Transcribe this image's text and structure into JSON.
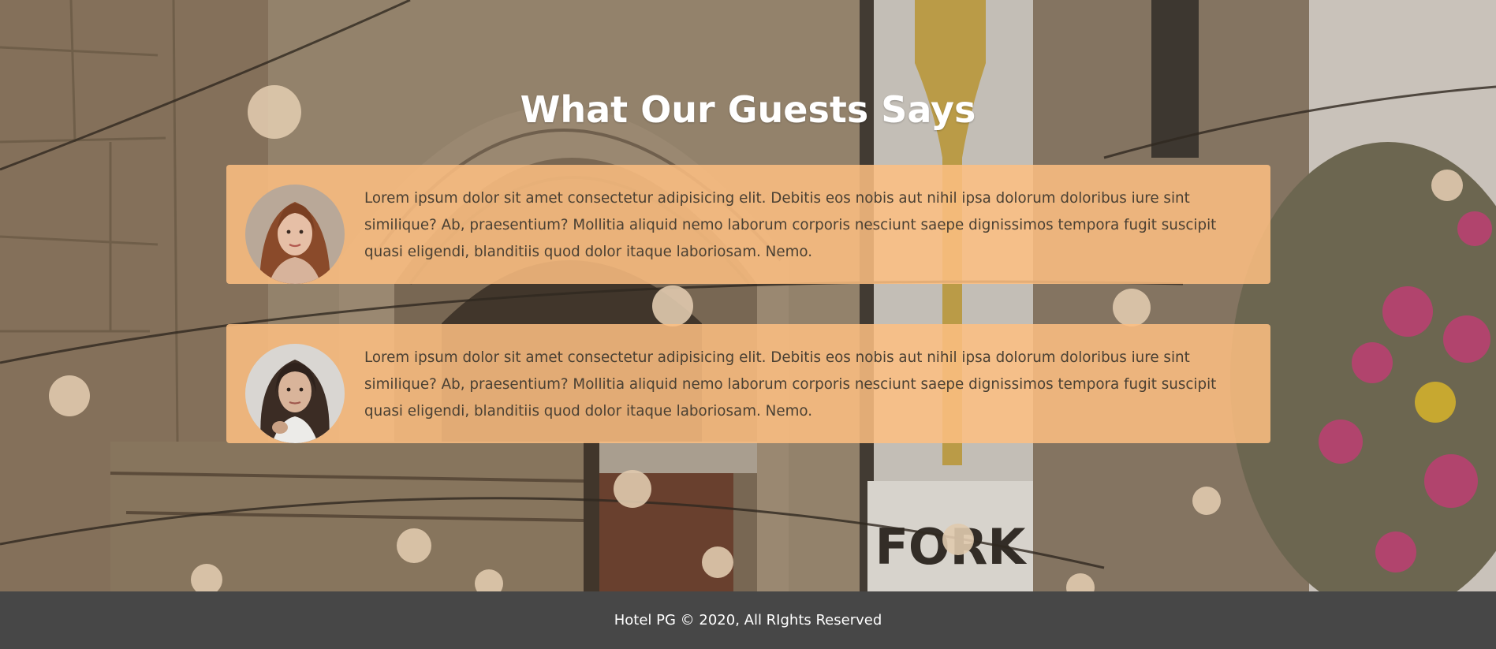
{
  "testimonials": {
    "heading": "What Our Guests Says",
    "items": [
      {
        "text": "Lorem ipsum dolor sit amet consectetur adipisicing elit. Debitis eos nobis aut nihil ipsa dolorum doloribus iure sint similique? Ab, praesentium? Mollitia aliquid nemo laborum corporis nesciunt saepe dignissimos tempora fugit suscipit quasi eligendi, blanditiis quod dolor itaque laboriosam. Nemo.",
        "avatar_icon": "guest-avatar-woman-auburn-hair"
      },
      {
        "text": "Lorem ipsum dolor sit amet consectetur adipisicing elit. Debitis eos nobis aut nihil ipsa dolorum doloribus iure sint similique? Ab, praesentium? Mollitia aliquid nemo laborum corporis nesciunt saepe dignissimos tempora fugit suscipit quasi eligendi, blanditiis quod dolor itaque laboriosam. Nemo.",
        "avatar_icon": "guest-avatar-woman-dark-hair"
      }
    ]
  },
  "background": {
    "sign_text": "FORK"
  },
  "footer": {
    "text": "Hotel PG © 2020, All RIghts Reserved"
  },
  "colors": {
    "card_background": "#fdbf81",
    "footer_background": "#474747",
    "heading": "#ffffff",
    "body_text": "#4a4033"
  }
}
